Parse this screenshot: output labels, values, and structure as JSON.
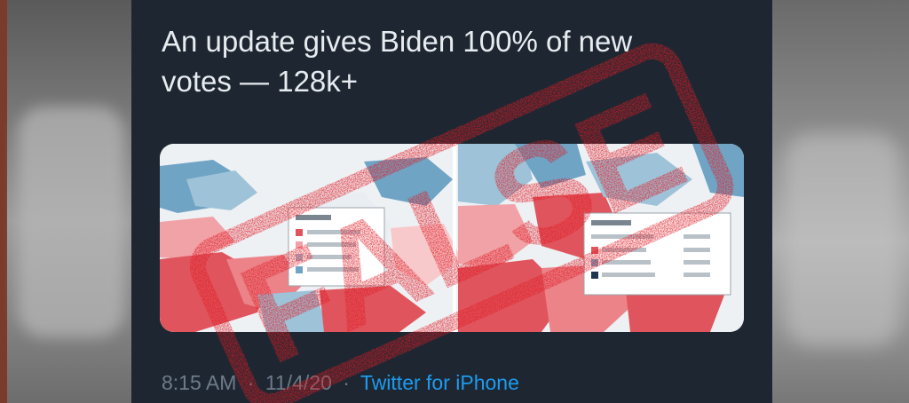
{
  "tweet": {
    "text_line1": "An update gives Biden 100% of new",
    "text_line2": "votes — 128k+",
    "time": "8:15 AM",
    "date": "11/4/20",
    "separator": "·",
    "source": "Twitter for iPhone"
  },
  "stamp": {
    "text": "FALSE",
    "color": "#e01b24"
  },
  "colors": {
    "card_background": "#1e2731",
    "text": "#e7ecf0",
    "meta": "#6e7b88",
    "link": "#1d9bf0",
    "map_red": "#e0555d",
    "map_blue": "#6fa4c4"
  }
}
